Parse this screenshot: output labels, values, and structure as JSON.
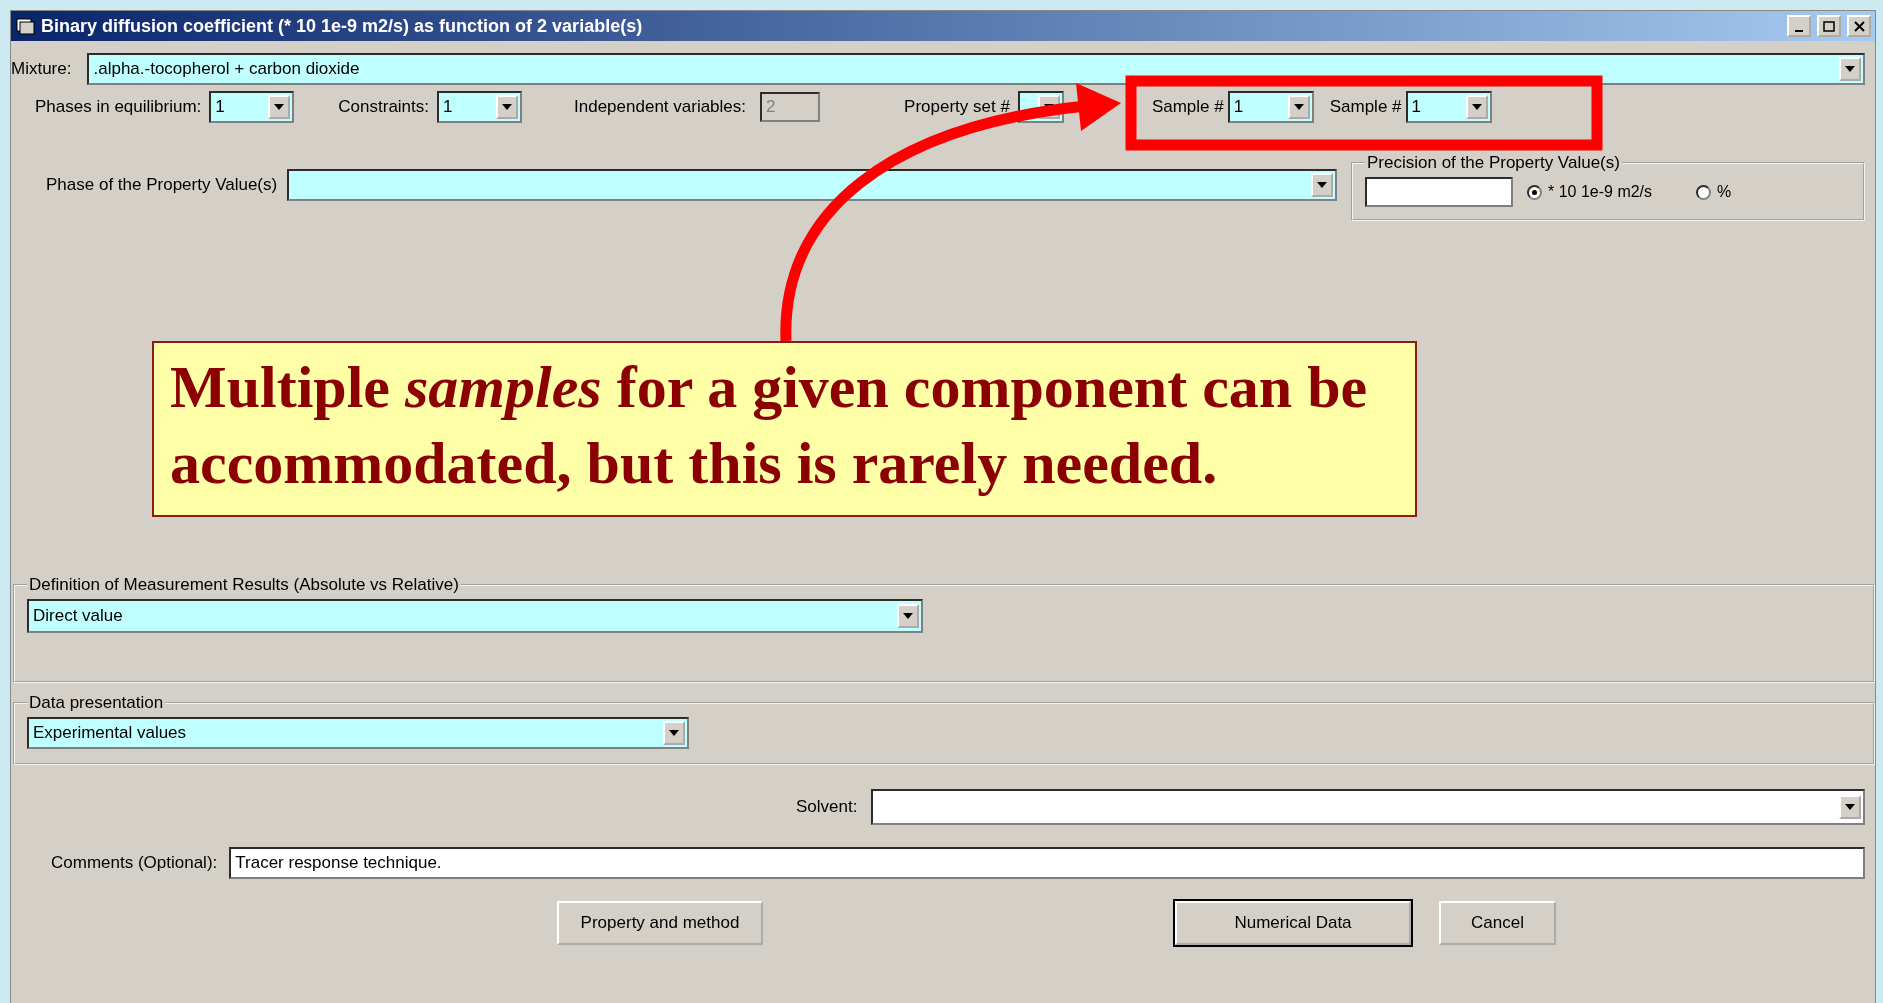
{
  "window": {
    "title": "Binary diffusion coefficient (* 10 1e-9 m2/s) as function of 2 variable(s)"
  },
  "mixture": {
    "label": "Mixture:",
    "value": ".alpha.-tocopherol + carbon dioxide"
  },
  "phases": {
    "label": "Phases in equilibrium:",
    "value": "1"
  },
  "constraints": {
    "label": "Constraints:",
    "value": "1"
  },
  "independent_variables": {
    "label": "Independent variables:",
    "value": "2",
    "disabled": true
  },
  "property_set": {
    "label": "Property set #"
  },
  "samples": [
    {
      "label": "Sample #",
      "value": "1"
    },
    {
      "label": "Sample #",
      "value": "1"
    }
  ],
  "phase_of_property": {
    "label": "Phase of the Property Value(s)"
  },
  "precision": {
    "label": "Precision of the Property Value(s)",
    "units": [
      {
        "label": "* 10 1e-9 m2/s",
        "selected": true
      },
      {
        "label": "%",
        "selected": false
      }
    ]
  },
  "callout": {
    "text": "Multiple *samples* for a given component can be accommodated, but this is rarely needed."
  },
  "definition": {
    "label": "Definition of Measurement Results (Absolute vs Relative)",
    "value": "Direct value"
  },
  "data_presentation": {
    "label": "Data presentation",
    "value": "Experimental values"
  },
  "solvent": {
    "label": "Solvent:"
  },
  "comments": {
    "label": "Comments (Optional):",
    "value": "Tracer response technique."
  },
  "buttons": [
    {
      "label": "Property and method",
      "default": false
    },
    {
      "label": "Numerical Data",
      "default": true
    },
    {
      "label": "Cancel",
      "default": false
    }
  ]
}
